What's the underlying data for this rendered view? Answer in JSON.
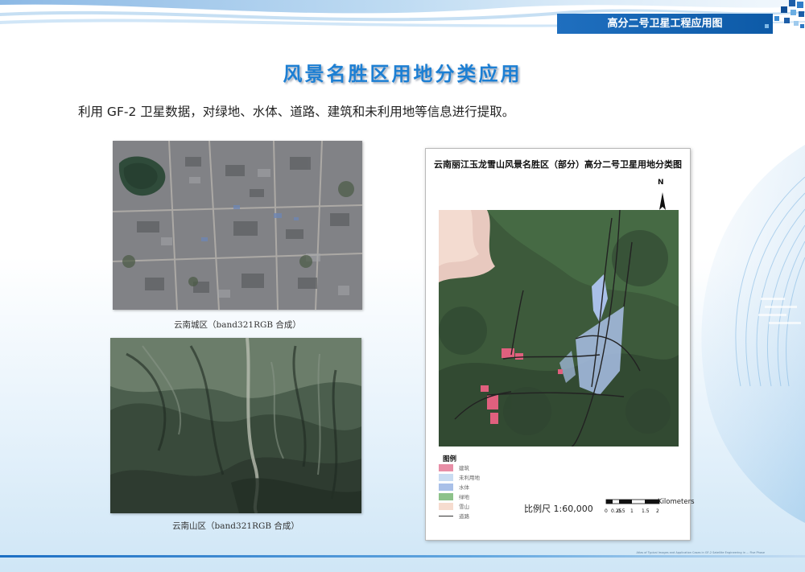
{
  "header": {
    "title": "高分二号卫星工程应用图"
  },
  "page": {
    "title": "风景名胜区用地分类应用",
    "intro": "利用 GF-2 卫星数据，对绿地、水体、道路、建筑和未利用地等信息进行提取。"
  },
  "images": [
    {
      "caption": "云南城区（band321RGB 合成）"
    },
    {
      "caption": "云南山区（band321RGB 合成）"
    }
  ],
  "map": {
    "title": "云南丽江玉龙雪山风景名胜区（部分）高分二号卫星用地分类图",
    "north_label": "N",
    "legend_title": "图例",
    "legend": [
      {
        "label": "建筑",
        "color": "#e88ea6"
      },
      {
        "label": "未利用地",
        "color": "#c9dcf2"
      },
      {
        "label": "水体",
        "color": "#a9c0e8"
      },
      {
        "label": "绿地",
        "color": "#8dc28a"
      },
      {
        "label": "雪山",
        "color": "#f6dccf"
      },
      {
        "label": "道路",
        "color": "#333333",
        "line": true
      }
    ],
    "scale_text": "比例尺 1:60,000",
    "scale_unit": "Kilometers",
    "scale_ticks": [
      "0",
      "0.25",
      "0.5",
      "1",
      "1.5",
      "2"
    ]
  },
  "footer": {
    "text": "Atlas of Typical Images and Application Cases in GF-2 Satellite Engineering in ... Five Phase"
  },
  "colors": {
    "accent": "#1d7fd3",
    "header_bar": "#1565b8"
  }
}
